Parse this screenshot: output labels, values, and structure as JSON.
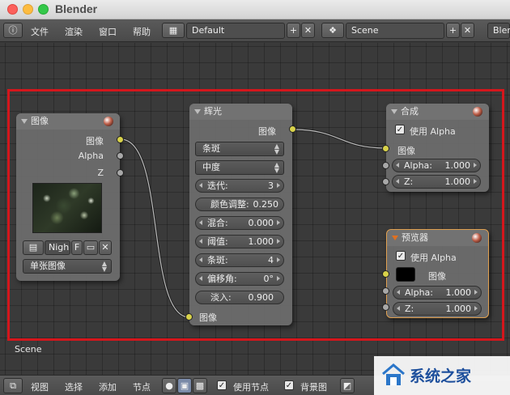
{
  "window": {
    "app_title": "Blender"
  },
  "menubar": {
    "items": [
      "文件",
      "渲染",
      "窗口",
      "帮助"
    ],
    "screen_layout": "Default",
    "scene": "Scene",
    "engine": "Blen"
  },
  "nodes": {
    "image": {
      "title": "图像",
      "outputs": [
        "图像",
        "Alpha",
        "Z"
      ],
      "image_name": "Nigh",
      "fake_user": "F",
      "source": "单张图像"
    },
    "glare": {
      "title": "辉光",
      "output": "图像",
      "glare_type": "条斑",
      "quality": "中度",
      "fields": [
        {
          "label": "迭代:",
          "value": "3"
        },
        {
          "label": "颜色调整:",
          "value": "0.250"
        },
        {
          "label": "混合:",
          "value": "0.000"
        },
        {
          "label": "阈值:",
          "value": "1.000"
        },
        {
          "label": "条斑:",
          "value": "4"
        },
        {
          "label": "偏移角:",
          "value": "0°"
        },
        {
          "label": "淡入:",
          "value": "0.900"
        }
      ],
      "input": "图像"
    },
    "composite": {
      "title": "合成",
      "use_alpha_label": "使用 Alpha",
      "input_image": "图像",
      "alpha_label": "Alpha:",
      "alpha_value": "1.000",
      "z_label": "Z:",
      "z_value": "1.000"
    },
    "viewer": {
      "title": "预览器",
      "use_alpha_label": "使用 Alpha",
      "input_image": "图像",
      "alpha_label": "Alpha:",
      "alpha_value": "1.000",
      "z_label": "Z:",
      "z_value": "1.000"
    }
  },
  "editor": {
    "scene_label": "Scene"
  },
  "bottombar": {
    "items": [
      "视图",
      "选择",
      "添加",
      "节点"
    ],
    "use_nodes_label": "使用节点",
    "backdrop_label": "背景图"
  },
  "watermark": {
    "text": "系统之家"
  },
  "colors": {
    "highlight_box": "#d4161c",
    "image_socket": "#d8d24a",
    "value_socket": "#a8a8a8"
  }
}
